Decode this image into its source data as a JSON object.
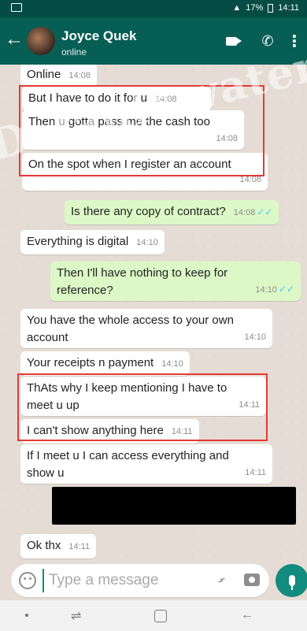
{
  "status_bar": {
    "battery": "17%",
    "time": "14:11"
  },
  "contact": {
    "name": "Joyce Quek",
    "status": "online"
  },
  "messages": [
    {
      "dir": "in",
      "text": "Online",
      "time": "14:08"
    },
    {
      "dir": "in",
      "text": "But I have to do it for u",
      "time": "14:08"
    },
    {
      "dir": "in",
      "text": "Then u gotta pass me the cash too",
      "time": "14:08"
    },
    {
      "dir": "in",
      "text": "On the spot when I register an account",
      "time": "14:08"
    },
    {
      "dir": "out",
      "text": "Is there any copy of contract?",
      "time": "14:08"
    },
    {
      "dir": "in",
      "text": "Everything is digital",
      "time": "14:10"
    },
    {
      "dir": "out",
      "text": "Then I'll have nothing to keep for reference?",
      "time": "14:10"
    },
    {
      "dir": "in",
      "text": "You have the whole access to your own account",
      "time": "14:10"
    },
    {
      "dir": "in",
      "text": "Your receipts n payment",
      "time": "14:10"
    },
    {
      "dir": "in",
      "text": "ThAts why I keep mentioning I have to meet u up",
      "time": "14:11"
    },
    {
      "dir": "in",
      "text": "I can't show anything here",
      "time": "14:11"
    },
    {
      "dir": "in",
      "text": "If I meet u I can access everything and show u",
      "time": "14:11"
    },
    {
      "dir": "in",
      "text": "Ok thx",
      "time": "14:11"
    }
  ],
  "composer": {
    "placeholder": "Type a message"
  },
  "watermark": "Default watermark",
  "colors": {
    "header": "#075e54",
    "status_bar": "#054d44",
    "outgoing_bubble": "#dcf8c6",
    "incoming_bubble": "#ffffff",
    "highlight_box": "#e53935",
    "accent": "#128c7e"
  }
}
